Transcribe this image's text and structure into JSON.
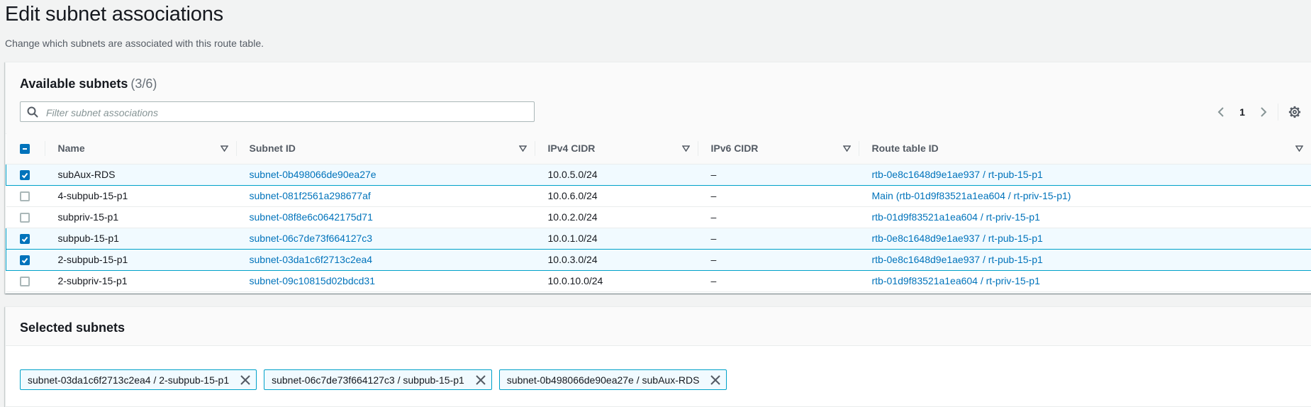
{
  "page": {
    "title": "Edit subnet associations",
    "subtitle": "Change which subnets are associated with this route table."
  },
  "available": {
    "title": "Available subnets",
    "counter": "(3/6)",
    "filter_placeholder": "Filter subnet associations",
    "filter_value": "",
    "page_number": "1",
    "columns": [
      "Name",
      "Subnet ID",
      "IPv4 CIDR",
      "IPv6 CIDR",
      "Route table ID"
    ],
    "rows": [
      {
        "checked": true,
        "name": "subAux-RDS",
        "subnet_id": "subnet-0b498066de90ea27e",
        "ipv4": "10.0.5.0/24",
        "ipv6": "–",
        "route_table": "rtb-0e8c1648d9e1ae937 / rt-pub-15-p1"
      },
      {
        "checked": false,
        "name": "4-subpub-15-p1",
        "subnet_id": "subnet-081f2561a298677af",
        "ipv4": "10.0.6.0/24",
        "ipv6": "–",
        "route_table": "Main (rtb-01d9f83521a1ea604 / rt-priv-15-p1)"
      },
      {
        "checked": false,
        "name": "subpriv-15-p1",
        "subnet_id": "subnet-08f8e6c0642175d71",
        "ipv4": "10.0.2.0/24",
        "ipv6": "–",
        "route_table": "rtb-01d9f83521a1ea604 / rt-priv-15-p1"
      },
      {
        "checked": true,
        "name": "subpub-15-p1",
        "subnet_id": "subnet-06c7de73f664127c3",
        "ipv4": "10.0.1.0/24",
        "ipv6": "–",
        "route_table": "rtb-0e8c1648d9e1ae937 / rt-pub-15-p1"
      },
      {
        "checked": true,
        "name": "2-subpub-15-p1",
        "subnet_id": "subnet-03da1c6f2713c2ea4",
        "ipv4": "10.0.3.0/24",
        "ipv6": "–",
        "route_table": "rtb-0e8c1648d9e1ae937 / rt-pub-15-p1"
      },
      {
        "checked": false,
        "name": "2-subpriv-15-p1",
        "subnet_id": "subnet-09c10815d02bdcd31",
        "ipv4": "10.0.10.0/24",
        "ipv6": "–",
        "route_table": "rtb-01d9f83521a1ea604 / rt-priv-15-p1"
      }
    ]
  },
  "selected": {
    "title": "Selected subnets",
    "tokens": [
      "subnet-03da1c6f2713c2ea4 / 2-subpub-15-p1",
      "subnet-06c7de73f664127c3 / subpub-15-p1",
      "subnet-0b498066de90ea27e / subAux-RDS"
    ]
  },
  "icons": {
    "search": "search-icon",
    "prev": "chevron-left-icon",
    "next": "chevron-right-icon",
    "settings": "gear-icon",
    "sort": "sort-caret-down-icon",
    "dismiss": "close-icon"
  },
  "colors": {
    "link": "#0073bb",
    "selection_border": "#00a1c9",
    "selection_bg": "#f1faff",
    "checkbox_checked": "#0073bb"
  }
}
